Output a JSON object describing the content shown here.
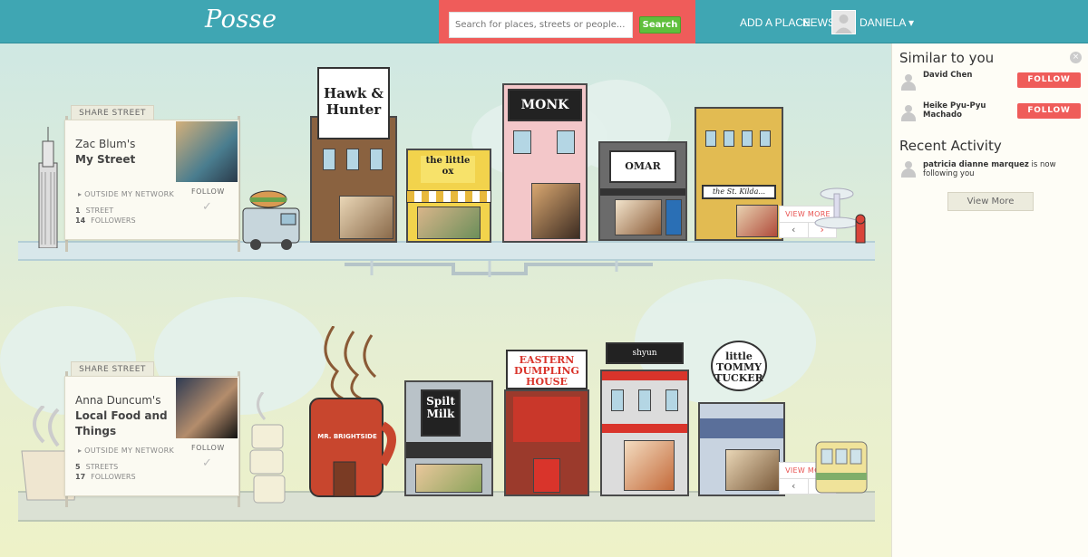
{
  "header": {
    "logo": "Posse",
    "search_placeholder": "Search for places, streets or people...",
    "search_button": "Search",
    "nav_add_place": "ADD A PLACE",
    "nav_news": "NEWS",
    "user_name": "DANIELA",
    "user_menu_glyph": "▾"
  },
  "streets": [
    {
      "share_label": "SHARE STREET",
      "owner": "Zac Blum's",
      "street_name": "My Street",
      "follow_label": "FOLLOW",
      "network_label": "OUTSIDE MY NETWORK",
      "streets_count": "1",
      "streets_label": "STREET",
      "followers_count": "14",
      "followers_label": "FOLLOWERS",
      "view_more": "VIEW MORE",
      "shops": [
        "Hawk & Hunter",
        "the little ox",
        "MONK",
        "OMAR",
        "the St. Kilda..."
      ]
    },
    {
      "share_label": "SHARE STREET",
      "owner": "Anna Duncum's",
      "street_name": "Local Food and Things",
      "follow_label": "FOLLOW",
      "network_label": "OUTSIDE MY NETWORK",
      "streets_count": "5",
      "streets_label": "STREETS",
      "followers_count": "17",
      "followers_label": "FOLLOWERS",
      "view_more": "VIEW MORE",
      "shops": [
        "MR. BRIGHTSIDE",
        "Spilt Milk",
        "EASTERN DUMPLING HOUSE",
        "shyun",
        "little TOMMY TUCKER"
      ]
    }
  ],
  "sidebar": {
    "close_glyph": "×",
    "similar_title": "Similar to you",
    "people": [
      {
        "name": "David Chen",
        "follow": "FOLLOW"
      },
      {
        "name": "Heike Pyu-Pyu Machado",
        "follow": "FOLLOW"
      }
    ],
    "recent_title": "Recent Activity",
    "activity_user": "patricia dianne marquez",
    "activity_text": "is now following you",
    "view_more": "View More"
  },
  "colors": {
    "topbar": "#3fa6b3",
    "accent_red": "#ef5c5a",
    "search_green": "#5fbf3c"
  }
}
